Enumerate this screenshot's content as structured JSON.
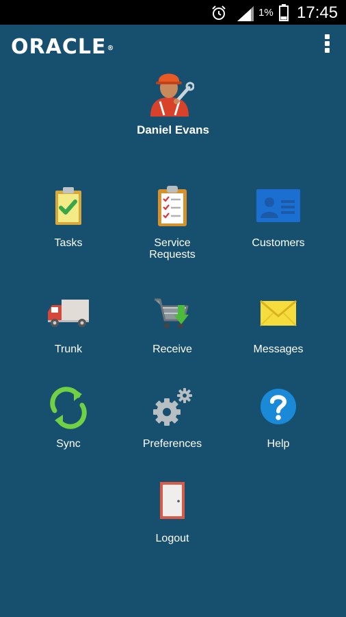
{
  "status_bar": {
    "battery": "1%",
    "time": "17:45"
  },
  "header": {
    "logo_text": "ORACLE",
    "logo_mark": "®",
    "menu_icon": "overflow-menu-icon"
  },
  "profile": {
    "name": "Daniel Evans",
    "avatar_icon": "technician-avatar-icon"
  },
  "menu": [
    {
      "label": "Tasks",
      "icon": "clipboard-check-icon"
    },
    {
      "label": "Service\nRequests",
      "icon": "checklist-icon"
    },
    {
      "label": "Customers",
      "icon": "contact-card-icon"
    },
    {
      "label": "Trunk",
      "icon": "truck-icon"
    },
    {
      "label": "Receive",
      "icon": "shopping-cart-icon"
    },
    {
      "label": "Messages",
      "icon": "envelope-icon"
    },
    {
      "label": "Sync",
      "icon": "sync-icon"
    },
    {
      "label": "Preferences",
      "icon": "gears-icon"
    },
    {
      "label": "Help",
      "icon": "help-icon"
    },
    {
      "label": "Logout",
      "icon": "door-icon"
    }
  ],
  "colors": {
    "background": "#17506f",
    "status_bar": "#000000",
    "help_blue": "#1a8ad8",
    "sync_green": "#6fd143",
    "message_yellow": "#f6dc3c"
  }
}
